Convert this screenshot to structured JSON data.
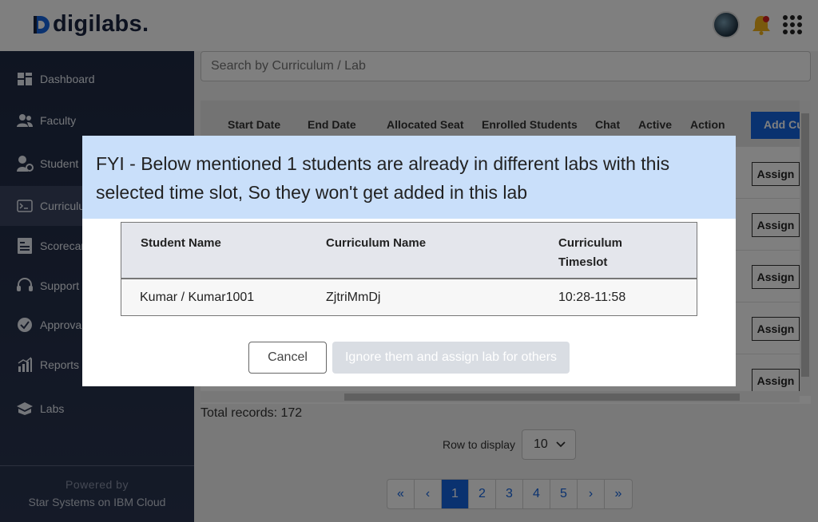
{
  "header": {
    "logo_text": "digilabs.",
    "brand_color": "#1565e0"
  },
  "sidebar": {
    "items": [
      {
        "label": "Dashboard",
        "icon": "dashboard-icon"
      },
      {
        "label": "Faculty",
        "icon": "faculty-icon"
      },
      {
        "label": "Student I",
        "icon": "student-icon"
      },
      {
        "label": "Curriculu",
        "icon": "curriculum-icon"
      },
      {
        "label": "Scorecar",
        "icon": "scorecard-icon"
      },
      {
        "label": "Support",
        "icon": "support-icon"
      },
      {
        "label": "Approval",
        "icon": "approval-icon"
      },
      {
        "label": "Reports",
        "icon": "reports-icon"
      },
      {
        "label": "Labs",
        "icon": "labs-icon"
      }
    ],
    "active_index": 3,
    "footer_powered": "Powered by",
    "footer_company": "Star Systems on IBM Cloud"
  },
  "search": {
    "placeholder": "Search by Curriculum / Lab"
  },
  "table": {
    "columns": [
      "Start Date",
      "End Date",
      "Allocated Seat",
      "Enrolled Students",
      "Chat",
      "Active",
      "Action"
    ],
    "add_button": "Add Cu",
    "assign_label": "Assign",
    "row_count_visible": 5
  },
  "footer": {
    "total_records": "Total records: 172",
    "rows_label": "Row to display",
    "rows_value": "10",
    "pages": [
      "«",
      "‹",
      "1",
      "2",
      "3",
      "4",
      "5",
      "›",
      "»"
    ],
    "active_page": "1"
  },
  "modal": {
    "message": "FYI - Below mentioned 1 students are already in different labs with this selected time slot, So they won't get added in this lab",
    "columns": [
      "Student Name",
      "Curriculum Name",
      "Curriculum Timeslot"
    ],
    "rows": [
      {
        "student": "Kumar / Kumar1001",
        "curriculum": "ZjtriMmDj",
        "timeslot": "10:28-11:58"
      }
    ],
    "cancel_label": "Cancel",
    "ignore_label": "Ignore them and assign lab for others"
  }
}
